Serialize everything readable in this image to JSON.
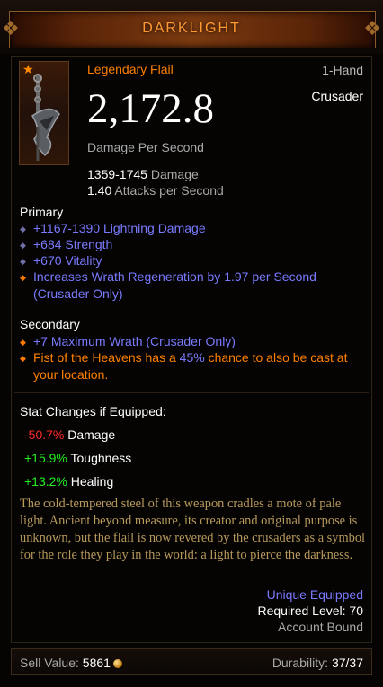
{
  "header": {
    "title": "DARKLIGHT"
  },
  "item": {
    "type": "Legendary Flail",
    "hand": "1-Hand",
    "class": "Crusader",
    "dps": "2,172.8",
    "dps_label": "Damage Per Second",
    "damage_range": "1359-1745",
    "damage_label": "Damage",
    "attack_speed": "1.40",
    "attack_speed_label": "Attacks per Second"
  },
  "primary": {
    "heading": "Primary",
    "affixes": [
      "+1167-1390 Lightning Damage",
      "+684 Strength",
      "+670 Vitality"
    ],
    "legendary_affix": "Increases Wrath Regeneration by 1.97 per Second",
    "legendary_affix_note": "(Crusader Only)"
  },
  "secondary": {
    "heading": "Secondary",
    "affix": "+7 Maximum Wrath (Crusader Only)",
    "legendary_part1": "Fist of the Heavens has a",
    "legendary_chance": "45%",
    "legendary_part2": "chance to also be cast at",
    "legendary_part3": "your location."
  },
  "stat_changes": {
    "heading": "Stat Changes if Equipped:",
    "rows": [
      {
        "value": "-50.7%",
        "label": "Damage",
        "color": "#ff2a2a"
      },
      {
        "value": "+15.9%",
        "label": "Toughness",
        "color": "#22ee22"
      },
      {
        "value": "+13.2%",
        "label": "Healing",
        "color": "#22ee22"
      }
    ]
  },
  "flavor": "The cold-tempered steel of this weapon cradles a mote of pale light. Ancient beyond measure, its creator and original purpose is unknown, but the flail is now revered by the crusaders as a symbol for the role they play in the world: a light to pierce the darkness.",
  "requirements": {
    "unique": "Unique Equipped",
    "required_level": "Required Level: 70",
    "bound": "Account Bound"
  },
  "footer": {
    "sell_label": "Sell Value:",
    "sell_value": "5861",
    "durability_label": "Durability:",
    "durability_value": "37/37"
  },
  "icons": {
    "legendary_marker": "star-icon",
    "item_image": "flail-icon",
    "currency": "gold-coin-icon"
  },
  "colors": {
    "legendary": "#ff8000",
    "magic": "#7a7aff",
    "flavor": "#b89a5c"
  }
}
